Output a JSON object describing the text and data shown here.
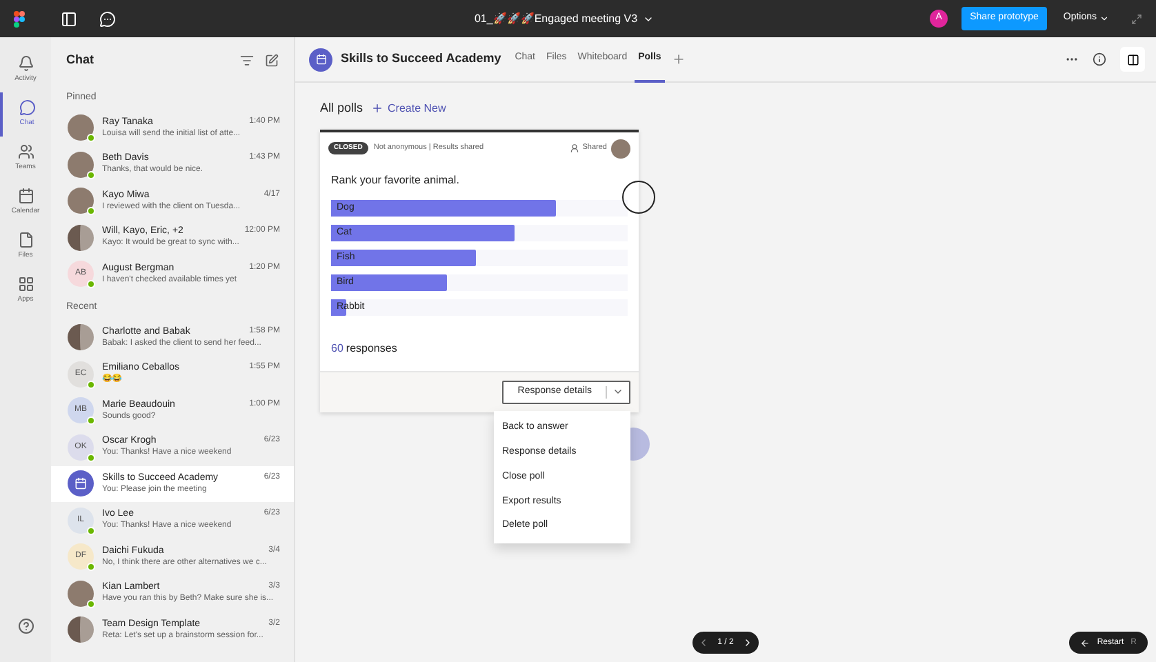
{
  "top_bar": {
    "file_title": "01_🚀🚀🚀Engaged meeting V3",
    "user_initial": "A",
    "share_button": "Share prototype",
    "options_menu": "Options"
  },
  "rail": {
    "items": [
      {
        "kind": "bell",
        "label": "Activity",
        "selected": false
      },
      {
        "kind": "chat",
        "label": "Chat",
        "selected": true
      },
      {
        "kind": "teams",
        "label": "Teams",
        "selected": false
      },
      {
        "kind": "calendar",
        "label": "Calendar",
        "selected": false
      },
      {
        "kind": "files",
        "label": "Files",
        "selected": false
      },
      {
        "kind": "apps",
        "label": "Apps",
        "selected": false
      }
    ]
  },
  "chat_list": {
    "title": "Chat",
    "sections": [
      {
        "heading": "Pinned",
        "items": [
          {
            "kind": "photo",
            "name": "Ray Tanaka",
            "time": "1:40 PM",
            "preview": "Louisa will send the initial list of atte...",
            "online": true,
            "selected": false
          },
          {
            "kind": "photo",
            "name": "Beth Davis",
            "time": "1:43 PM",
            "preview": "Thanks, that would be nice.",
            "online": true,
            "selected": false
          },
          {
            "kind": "photo",
            "name": "Kayo Miwa",
            "time": "4/17",
            "preview": "I reviewed with the client on Tuesda...",
            "online": true,
            "selected": false
          },
          {
            "kind": "group",
            "name": "Will, Kayo, Eric, +2",
            "time": "12:00 PM",
            "preview": "Kayo: It would be great to sync with...",
            "online": false,
            "selected": false
          },
          {
            "kind": "initials",
            "initials": "AB",
            "color": "#f6d9dc",
            "name": "August Bergman",
            "time": "1:20 PM",
            "preview": "I haven't checked available times yet",
            "online": true,
            "selected": false
          }
        ]
      },
      {
        "heading": "Recent",
        "items": [
          {
            "kind": "group",
            "name": "Charlotte and Babak",
            "time": "1:58 PM",
            "preview": "Babak: I asked the client to send her feed...",
            "online": false,
            "selected": false
          },
          {
            "kind": "initials",
            "initials": "EC",
            "color": "#e1dfdd",
            "name": "Emiliano Ceballos",
            "time": "1:55 PM",
            "preview": "😂😂",
            "online": true,
            "selected": false
          },
          {
            "kind": "initials",
            "initials": "MB",
            "color": "#cfd7ee",
            "name": "Marie Beaudouin",
            "time": "1:00 PM",
            "preview": "Sounds good?",
            "online": true,
            "selected": false
          },
          {
            "kind": "initials",
            "initials": "OK",
            "color": "#dcdcec",
            "name": "Oscar Krogh",
            "time": "6/23",
            "preview": "You: Thanks! Have a nice weekend",
            "online": true,
            "selected": false
          },
          {
            "kind": "channel",
            "name": "Skills to Succeed Academy",
            "time": "6/23",
            "preview": "You: Please join the meeting",
            "online": false,
            "selected": true
          },
          {
            "kind": "initials",
            "initials": "IL",
            "color": "#dde3ec",
            "name": "Ivo Lee",
            "time": "6/23",
            "preview": "You: Thanks! Have a nice weekend",
            "online": true,
            "selected": false
          },
          {
            "kind": "initials",
            "initials": "DF",
            "color": "#f6e8c9",
            "name": "Daichi Fukuda",
            "time": "3/4",
            "preview": "No, I think there are other alternatives we c...",
            "online": true,
            "selected": false
          },
          {
            "kind": "photo",
            "name": "Kian Lambert",
            "time": "3/3",
            "preview": "Have you ran this by Beth? Make sure she is...",
            "online": true,
            "selected": false
          },
          {
            "kind": "group",
            "name": "Team Design Template",
            "time": "3/2",
            "preview": "Reta: Let's set up a brainstorm session for...",
            "online": false,
            "selected": false
          }
        ]
      }
    ]
  },
  "meeting_header": {
    "title": "Skills to Succeed Academy",
    "tabs": [
      {
        "label": "Chat",
        "selected": false
      },
      {
        "label": "Files",
        "selected": false
      },
      {
        "label": "Whiteboard",
        "selected": false
      },
      {
        "label": "Polls",
        "selected": true
      }
    ]
  },
  "polls": {
    "heading": "All polls",
    "create_link": "Create New",
    "card": {
      "status": "CLOSED",
      "settings": "Not anonymous | Results shared",
      "shared": "Shared",
      "question": "Rank your favorite animal.",
      "options": [
        {
          "label": "Dog",
          "level": 0.76
        },
        {
          "label": "Cat",
          "level": 0.62
        },
        {
          "label": "Fish",
          "level": 0.49
        },
        {
          "label": "Bird",
          "level": 0.39
        },
        {
          "label": "Rabbit",
          "level": 0.05
        }
      ],
      "response_count": "60",
      "response_label": "responses",
      "action_button": "Response details",
      "menu": {
        "open": true,
        "items": [
          "Back to answer",
          "Response details",
          "Close poll",
          "Export results",
          "Delete poll"
        ]
      }
    }
  },
  "pager": {
    "page": "1 / 2"
  },
  "restart_button": {
    "label": "Restart",
    "shortcut": "R"
  }
}
